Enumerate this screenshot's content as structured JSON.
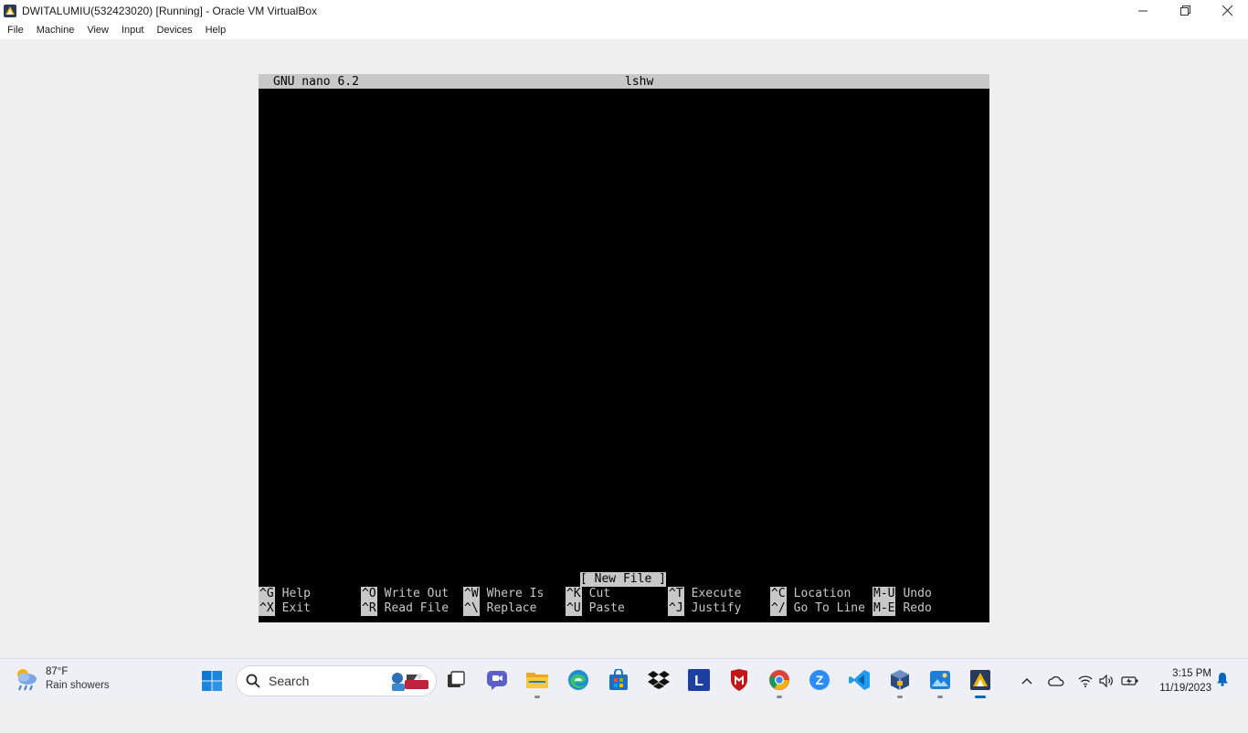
{
  "window": {
    "title": "DWITALUMIU(532423020) [Running] - Oracle VM VirtualBox",
    "controls": {
      "minimize": "—",
      "restore": "❐",
      "close": "✕"
    }
  },
  "menu": {
    "items": [
      "File",
      "Machine",
      "View",
      "Input",
      "Devices",
      "Help"
    ]
  },
  "nano": {
    "version": "GNU nano 6.2",
    "filename": "lshw",
    "status": "[ New File ]",
    "shortcuts_row1": [
      {
        "key": "^G",
        "label": "Help"
      },
      {
        "key": "^O",
        "label": "Write Out"
      },
      {
        "key": "^W",
        "label": "Where Is"
      },
      {
        "key": "^K",
        "label": "Cut"
      },
      {
        "key": "^T",
        "label": "Execute"
      },
      {
        "key": "^C",
        "label": "Location"
      },
      {
        "key": "M-U",
        "label": "Undo"
      }
    ],
    "shortcuts_row2": [
      {
        "key": "^X",
        "label": "Exit"
      },
      {
        "key": "^R",
        "label": "Read File"
      },
      {
        "key": "^\\",
        "label": "Replace"
      },
      {
        "key": "^U",
        "label": "Paste"
      },
      {
        "key": "^J",
        "label": "Justify"
      },
      {
        "key": "^/",
        "label": "Go To Line"
      },
      {
        "key": "M-E",
        "label": "Redo"
      }
    ]
  },
  "taskbar": {
    "weather": {
      "temp": "87°F",
      "desc": "Rain showers"
    },
    "search_label": "Search",
    "apps": [
      "task-view-icon",
      "teams-chat-icon",
      "file-explorer-icon",
      "edge-icon",
      "microsoft-store-icon",
      "dropbox-icon",
      "l-app-icon",
      "mcafee-icon",
      "chrome-icon",
      "zoom-icon",
      "vscode-icon",
      "virtualbox-icon",
      "photos-icon",
      "virtualbox-vm-icon"
    ],
    "clock": {
      "time": "3:15 PM",
      "date": "11/19/2023"
    }
  },
  "colors": {
    "terminal_bg": "#000000",
    "terminal_fg": "#c8c8c8",
    "taskbar_bg": "#eef0f5",
    "accent_blue": "#0067c0"
  }
}
